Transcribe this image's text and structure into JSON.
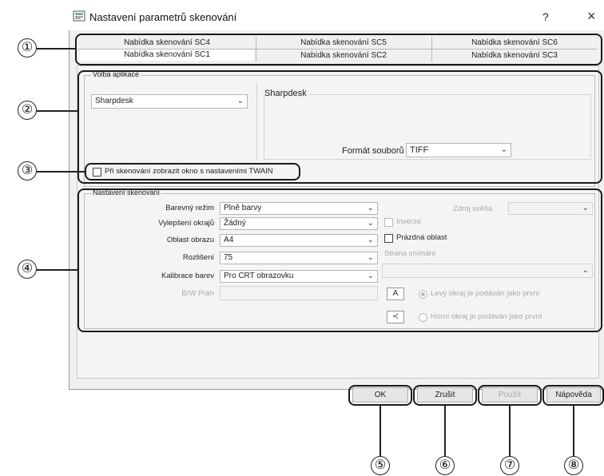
{
  "window": {
    "title": "Nastavení parametrů skenování",
    "help_label": "?",
    "close_label": "×"
  },
  "tabs": {
    "row1": [
      "Nabídka skenování SC4",
      "Nabídka skenování SC5",
      "Nabídka skenování SC6"
    ],
    "row2": [
      "Nabídka skenování SC1",
      "Nabídka skenování SC2",
      "Nabídka skenování SC3"
    ]
  },
  "app_choice": {
    "group_label": "Volba aplikace",
    "selected_app": "Sharpdesk",
    "detail_title": "Sharpdesk",
    "file_format_label": "Formát souborů",
    "file_format_value": "TIFF",
    "twain_checkbox_label": "Při skenování zobrazit okno s nastaveními TWAIN"
  },
  "scan_settings": {
    "group_label": "Nastavení skenování",
    "color_mode_label": "Barevný režim",
    "color_mode_value": "Plně barvy",
    "edge_enhance_label": "Vylepšení okrajů",
    "edge_enhance_value": "Žádný",
    "area_label": "Oblast obrazu",
    "area_value": "A4",
    "resolution_label": "Rozlišení",
    "resolution_value": "75",
    "calibration_label": "Kalibrace barev",
    "calibration_value": "Pro CRT obrazovku",
    "bw_threshold_label": "B/W Práh",
    "light_source_label": "Zdroj světla",
    "inverse_label": "Inverze",
    "blank_area_label": "Prázdná oblast",
    "scan_side_label": "Strana snímání",
    "left_edge_label": "Levý okraj je podáván jako první",
    "top_edge_label": "Horní okraj je podáván jako první",
    "orient_icon_1": "A",
    "orient_icon_2": "≺"
  },
  "buttons": {
    "ok": "OK",
    "cancel": "Zrušit",
    "apply": "Použít",
    "help": "Nápověda"
  },
  "callouts": [
    "①",
    "②",
    "③",
    "④",
    "⑤",
    "⑥",
    "⑦",
    "⑧"
  ],
  "icons": {
    "app_icon": "scanner-settings-icon",
    "dropdown": "chevron-down-icon"
  }
}
